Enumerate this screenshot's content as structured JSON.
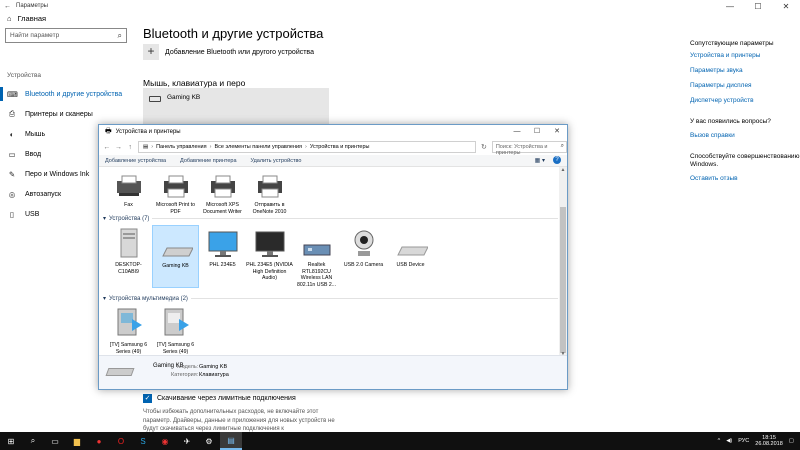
{
  "settings": {
    "window_title": "Параметры",
    "home": "Главная",
    "search_placeholder": "Найти параметр",
    "section": "Устройства",
    "nav": [
      {
        "label": "Bluetooth и другие устройства",
        "icon": "bluetooth-icon"
      },
      {
        "label": "Принтеры и сканеры",
        "icon": "printer-icon"
      },
      {
        "label": "Мышь",
        "icon": "mouse-icon"
      },
      {
        "label": "Ввод",
        "icon": "keyboard-icon"
      },
      {
        "label": "Перо и Windows Ink",
        "icon": "pen-icon"
      },
      {
        "label": "Автозапуск",
        "icon": "autoplay-icon"
      },
      {
        "label": "USB",
        "icon": "usb-icon"
      }
    ],
    "title": "Bluetooth и другие устройства",
    "add_device": "Добавление Bluetooth или другого устройства",
    "sub_heading": "Мышь, клавиатура и перо",
    "device_card": "Gaming KB",
    "metered_checkbox": "Скачивание через лимитные подключения",
    "metered_desc": "Чтобы избежать дополнительных расходов, не включайте этот параметр. Драйверы, данные и приложения для новых устройств не будут скачиваться через лимитные подключения к",
    "right": {
      "related_heading": "Сопутствующие параметры",
      "links": [
        "Устройства и принтеры",
        "Параметры звука",
        "Параметры дисплея",
        "Диспетчер устройств"
      ],
      "question": "У вас появились вопросы?",
      "help_link": "Вызов справки",
      "improve_text": "Способствуйте совершенствованию Windows.",
      "feedback_link": "Оставить отзыв"
    }
  },
  "devices_window": {
    "title": "Устройства и принтеры",
    "breadcrumb": [
      "Панель управления",
      "Все элементы панели управления",
      "Устройства и принтеры"
    ],
    "search_placeholder": "Поиск: Устройства и принтеры",
    "toolbar": [
      "Добавление устройства",
      "Добавление принтера",
      "Удалить устройство"
    ],
    "printers": [
      "Fax",
      "Microsoft Print to PDF",
      "Microsoft XPS Document Writer",
      "Отправить в OneNote 2010"
    ],
    "devices_header": "Устройства (7)",
    "devices": [
      "DESKTOP-C10ABI9",
      "Gaming KB",
      "PHL 234E5",
      "PHL 234E5 (NVIDIA High Definition Audio)",
      "Realtek RTL8192CU Wireless LAN 802.11n USB 2...",
      "USB 2.0 Camera",
      "USB Device"
    ],
    "multimedia_header": "Устройства мультимедиа (2)",
    "multimedia": [
      "[TV] Samsung 6 Series (49)",
      "[TV] Samsung 6 Series (49)"
    ],
    "details": {
      "name": "Gaming KB",
      "model_label": "Модель:",
      "model_value": "Gaming KB",
      "category_label": "Категория:",
      "category_value": "Клавиатура"
    }
  },
  "taskbar": {
    "lang": "РУС",
    "time": "18:15",
    "date": "26.08.2018"
  }
}
